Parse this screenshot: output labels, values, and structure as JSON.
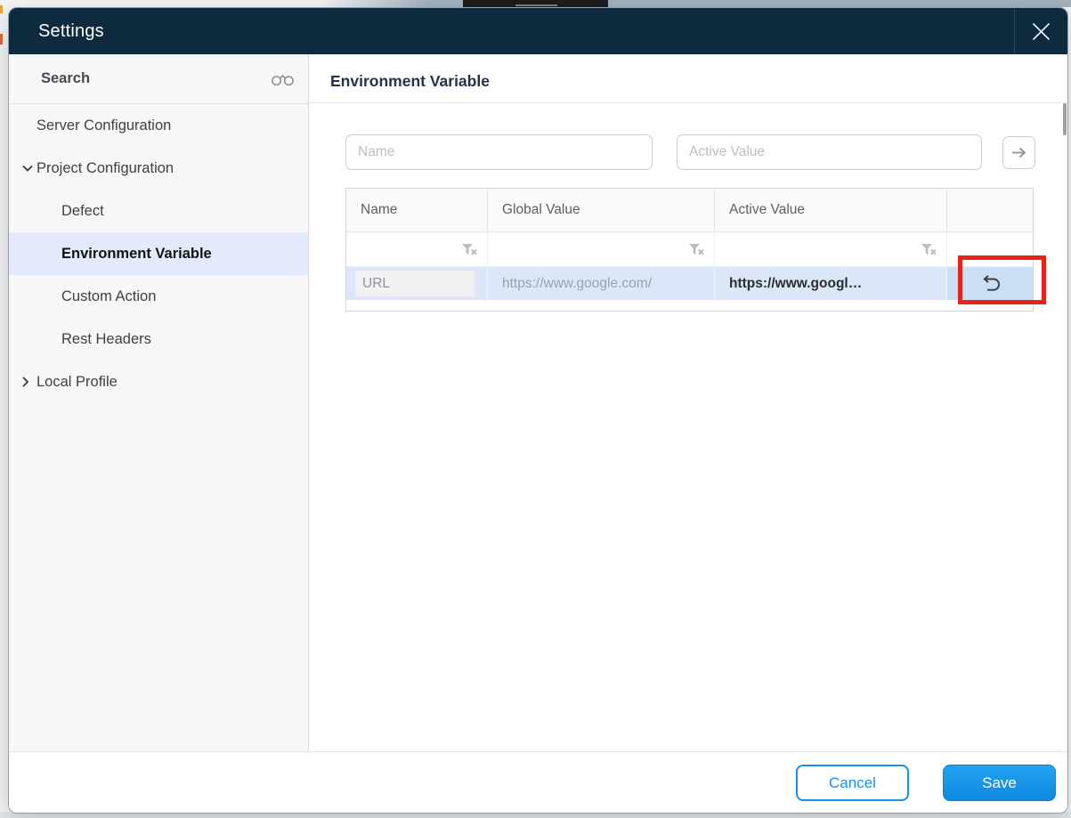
{
  "window": {
    "title": "Settings"
  },
  "sidebar": {
    "search_label": "Search",
    "items": [
      {
        "label": "Server Configuration",
        "level": 1,
        "chevron": "none",
        "selected": false
      },
      {
        "label": "Project Configuration",
        "level": 1,
        "chevron": "down",
        "selected": false
      },
      {
        "label": "Defect",
        "level": 2,
        "chevron": "none",
        "selected": false
      },
      {
        "label": "Environment Variable",
        "level": 2,
        "chevron": "none",
        "selected": true
      },
      {
        "label": "Custom Action",
        "level": 2,
        "chevron": "none",
        "selected": false
      },
      {
        "label": "Rest Headers",
        "level": 2,
        "chevron": "none",
        "selected": false
      },
      {
        "label": "Local Profile",
        "level": 1,
        "chevron": "right",
        "selected": false
      }
    ]
  },
  "main": {
    "title": "Environment Variable",
    "form": {
      "name_placeholder": "Name",
      "active_value_placeholder": "Active Value",
      "submit_icon": "arrow-right-icon"
    },
    "table": {
      "columns": [
        "Name",
        "Global Value",
        "Active Value",
        ""
      ],
      "filter_icon": "filter-clear-icon",
      "rows": [
        {
          "name": "URL",
          "global_value": "https://www.google.com/",
          "active_value": "https://www.googl…",
          "action_icon": "undo-icon"
        }
      ]
    }
  },
  "footer": {
    "cancel_label": "Cancel",
    "save_label": "Save"
  },
  "annotation": {
    "shape": "red-rectangle",
    "color": "#e8231a",
    "target": "revert-button"
  },
  "colors": {
    "header_bg": "#0d2a3f",
    "accent_blue": "#1490e8",
    "sidebar_selected_bg": "#e2eafb",
    "row_highlight_bg": "#dbe7f9",
    "action_cell_bg": "#c8dff5",
    "annotation_red": "#e8231a"
  },
  "icons": {
    "search": "binoculars-icon",
    "close": "close-icon",
    "expand_open": "chevron-down-icon",
    "expand_closed": "chevron-right-icon",
    "submit": "arrow-right-icon",
    "filter": "filter-clear-icon",
    "revert": "undo-icon",
    "notch_handle": "drag-handle-icon"
  }
}
